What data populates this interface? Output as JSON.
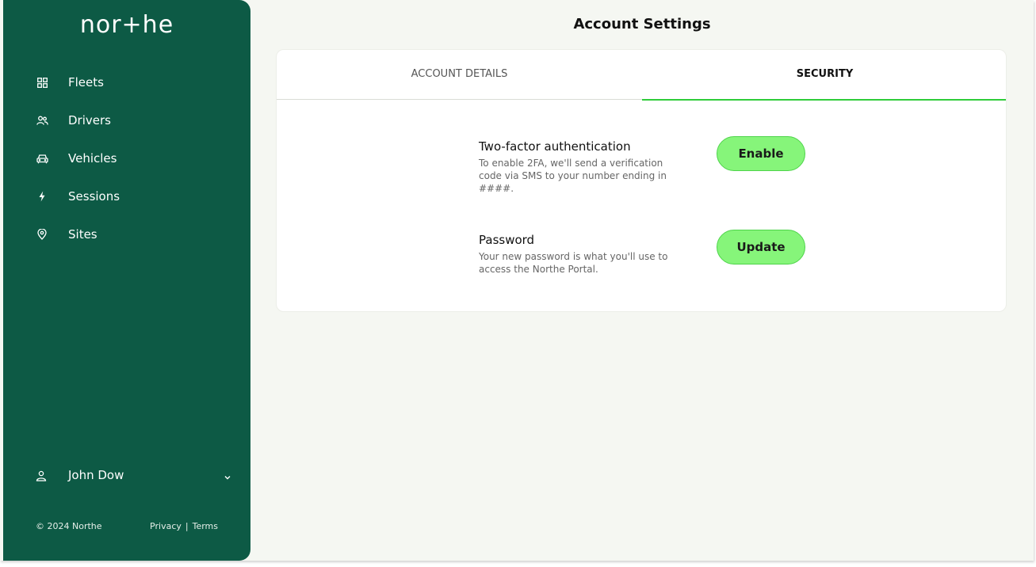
{
  "app": {
    "brand": "nor+he",
    "page_title": "Account Settings"
  },
  "sidebar": {
    "items": [
      {
        "label": "Fleets",
        "icon": "grid-icon"
      },
      {
        "label": "Drivers",
        "icon": "users-icon"
      },
      {
        "label": "Vehicles",
        "icon": "car-icon"
      },
      {
        "label": "Sessions",
        "icon": "bolt-icon"
      },
      {
        "label": "Sites",
        "icon": "map-pin-icon"
      }
    ],
    "user": {
      "name": "John Dow",
      "icon": "user-icon"
    },
    "footer": {
      "copyright": "© 2024 Northe",
      "privacy": "Privacy",
      "separator": "|",
      "terms": "Terms"
    }
  },
  "tabs": [
    {
      "label": "ACCOUNT DETAILS",
      "active": false
    },
    {
      "label": "SECURITY",
      "active": true
    }
  ],
  "security": {
    "two_factor": {
      "title": "Two-factor authentication",
      "description": "To enable 2FA, we'll send a verification code via SMS to your number ending in ####.",
      "button": "Enable"
    },
    "password": {
      "title": "Password",
      "description": "Your new password is what you'll use to access the Northe Portal.",
      "button": "Update"
    }
  },
  "colors": {
    "sidebar_bg": "#0d5a45",
    "accent": "#2fcc3a",
    "button_bg": "#86f57a",
    "page_bg": "#f5f7f2"
  }
}
